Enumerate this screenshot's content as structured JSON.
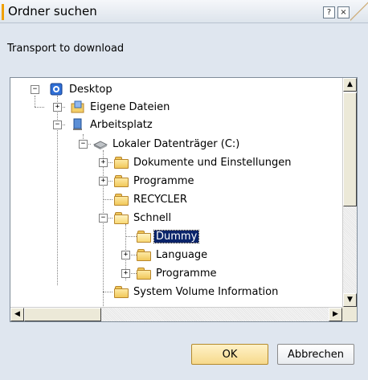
{
  "window": {
    "title": "Ordner suchen",
    "help_btn": "?",
    "close_btn": "×"
  },
  "prompt": "Transport to download",
  "tree": {
    "items": [
      {
        "label": "Desktop",
        "icon": "desktop-icon"
      },
      {
        "label": "Eigene Dateien",
        "icon": "my-documents-icon"
      },
      {
        "label": "Arbeitsplatz",
        "icon": "my-computer-icon"
      },
      {
        "label": "Lokaler Datenträger (C:)",
        "icon": "hard-drive-icon"
      },
      {
        "label": "Dokumente und Einstellungen",
        "icon": "folder-icon"
      },
      {
        "label": "Programme",
        "icon": "folder-icon"
      },
      {
        "label": "RECYCLER",
        "icon": "folder-icon"
      },
      {
        "label": "Schnell",
        "icon": "folder-icon"
      },
      {
        "label": "Dummy",
        "icon": "folder-open-icon",
        "selected": true
      },
      {
        "label": "Language",
        "icon": "folder-icon"
      },
      {
        "label": "Programme",
        "icon": "folder-icon"
      },
      {
        "label": "System Volume Information",
        "icon": "folder-icon"
      }
    ]
  },
  "buttons": {
    "ok": "OK",
    "cancel": "Abbrechen"
  },
  "colors": {
    "selection": "#0a246a",
    "ok_button": "#f6d98c",
    "title_accent": "#f0a000",
    "dialog_bg": "#dfe6ef"
  }
}
